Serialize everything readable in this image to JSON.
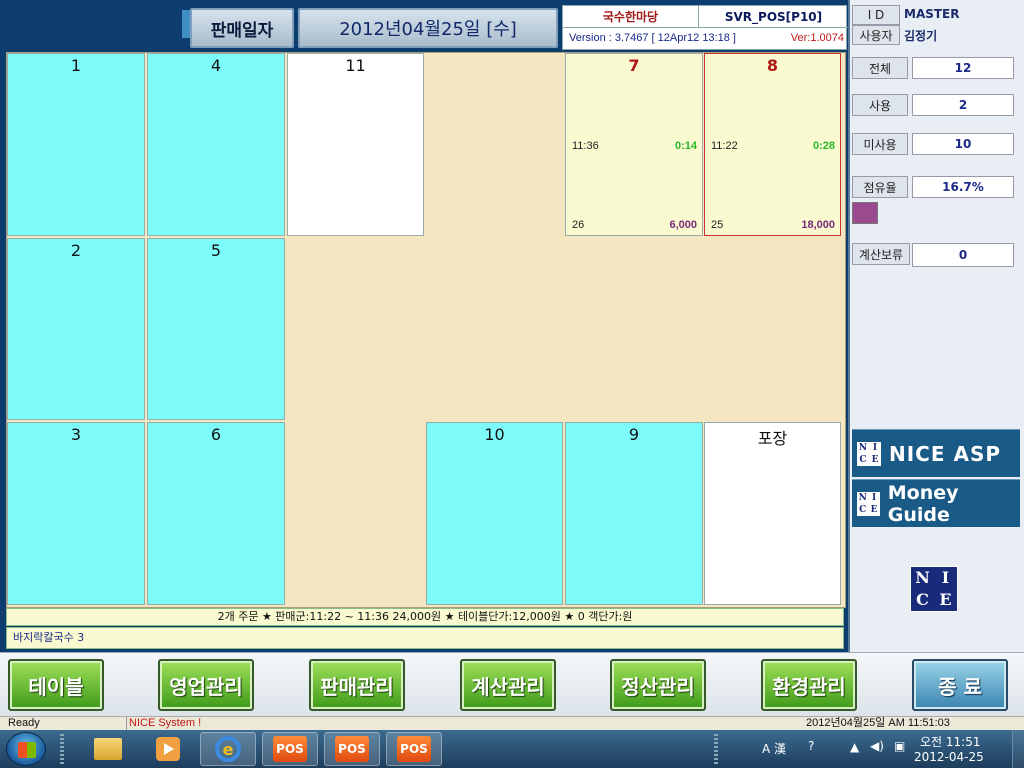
{
  "header": {
    "sale_date_label": "판매일자",
    "sale_date": "2012년04월25일 [수]",
    "store_name": "국수한마당",
    "server_name": "SVR_POS[P10]",
    "version": "Version : 3.7467 [ 12Apr12 13:18 ]",
    "ver": "Ver:1.0074"
  },
  "tables": [
    {
      "num": "1"
    },
    {
      "num": "4"
    },
    {
      "num": "11"
    },
    {
      "num": "7",
      "time": "11:36",
      "elapsed": "0:14",
      "count": "26",
      "amount": "6,000"
    },
    {
      "num": "8",
      "time": "11:22",
      "elapsed": "0:28",
      "count": "25",
      "amount": "18,000"
    },
    {
      "num": "2"
    },
    {
      "num": "5"
    },
    {
      "num": "3"
    },
    {
      "num": "6"
    },
    {
      "num": "10"
    },
    {
      "num": "9"
    },
    {
      "num": "포장"
    }
  ],
  "summary": "2개 주문   ★ 판매군:11:22 ~ 11:36   24,000원 ★ 테이블단가:12,000원 ★ 0 객단가:원",
  "menu_line": "바지락칼국수 3",
  "side": {
    "id_label": "I D",
    "id_value": "MASTER",
    "user_label": "사용자",
    "user_value": "김정기",
    "total_label": "전체",
    "total_value": "12",
    "used_label": "사용",
    "used_value": "2",
    "unused_label": "미사용",
    "unused_value": "10",
    "occupancy_label": "점유율",
    "occupancy_value": "16.7%",
    "hold_label": "계산보류",
    "hold_value": "0",
    "brand1": "NICE ASP",
    "brand2": "Money Guide",
    "logo_letters": [
      "N",
      "I",
      "C",
      "E"
    ]
  },
  "buttons": {
    "table": "테이블",
    "sales_mgmt": "영업관리",
    "sales_admin": "판매관리",
    "calc_mgmt": "계산관리",
    "settle_mgmt": "정산관리",
    "env_mgmt": "환경관리",
    "exit": "종 료"
  },
  "status": {
    "ready": "Ready",
    "system": "NICE System !",
    "datetime": "2012년04월25일    AM 11:51:03"
  },
  "taskbar": {
    "ie_glyph": "e",
    "pos_label": "POS",
    "tray_lang": "A 漢",
    "time": "오전 11:51",
    "date": "2012-04-25"
  },
  "colors": {
    "empty_table": "#7dfbfb",
    "occupied_table": "#fafad0",
    "takeout_table": "#ffffff",
    "floor": "#f5e6c2",
    "button_green": "#5fbf2a"
  }
}
